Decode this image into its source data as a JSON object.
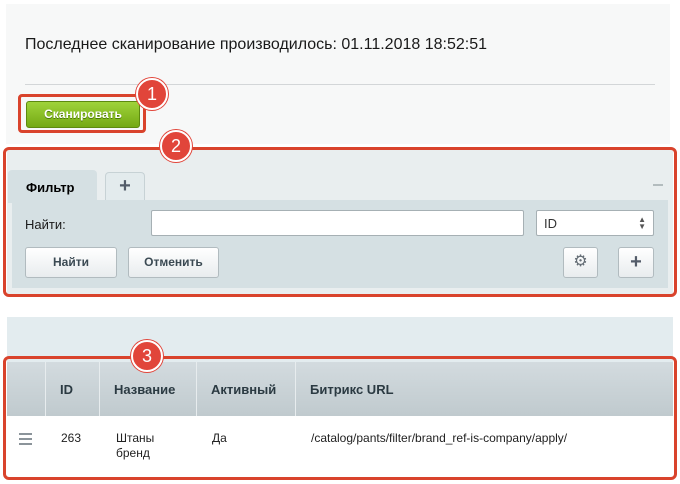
{
  "header": {
    "scan_info": "Последнее сканирование производилось: 01.11.2018 18:52:51",
    "scan_button_label": "Сканировать"
  },
  "badges": [
    "1",
    "2",
    "3"
  ],
  "filter": {
    "tab_label": "Фильтр",
    "add_tab_symbol": "+",
    "find_label": "Найти:",
    "search_value": "",
    "field_select_value": "ID",
    "find_button": "Найти",
    "cancel_button": "Отменить"
  },
  "table": {
    "columns": [
      "ID",
      "Название",
      "Активный",
      "Битрикс URL"
    ],
    "rows": [
      {
        "id": "263",
        "name_line1": "Штаны",
        "name_line2": "бренд",
        "active": "Да",
        "url": "/catalog/pants/filter/brand_ref-is-company/apply/"
      }
    ]
  },
  "colors": {
    "accent_green": "#74a914",
    "annotation_red": "#d9432c",
    "panel_bg": "#d5e0e3"
  },
  "icons": [
    "plus-icon",
    "minus-icon",
    "gear-icon",
    "plus-icon",
    "hamburger-icon",
    "chevron-updown-icon"
  ]
}
